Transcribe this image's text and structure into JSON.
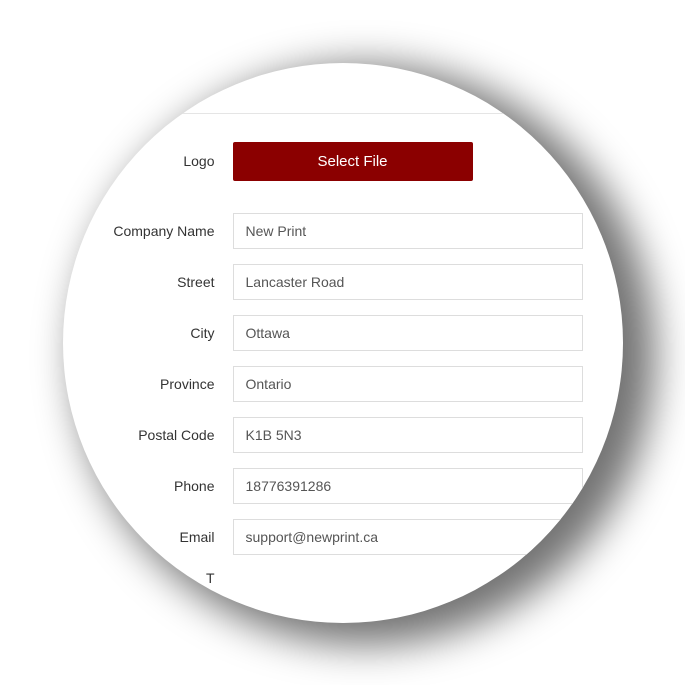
{
  "colors": {
    "primary": "#8b0000"
  },
  "form": {
    "logo": {
      "label": "Logo",
      "button": "Select File"
    },
    "company_name": {
      "label": "Company Name",
      "value": "New Print"
    },
    "street": {
      "label": "Street",
      "value": "Lancaster Road"
    },
    "city": {
      "label": "City",
      "value": "Ottawa"
    },
    "province": {
      "label": "Province",
      "value": "Ontario"
    },
    "postal_code": {
      "label": "Postal Code",
      "value": "K1B 5N3"
    },
    "phone": {
      "label": "Phone",
      "value": "18776391286"
    },
    "email": {
      "label": "Email",
      "value": "support@newprint.ca"
    },
    "partial": {
      "label": "T"
    }
  }
}
